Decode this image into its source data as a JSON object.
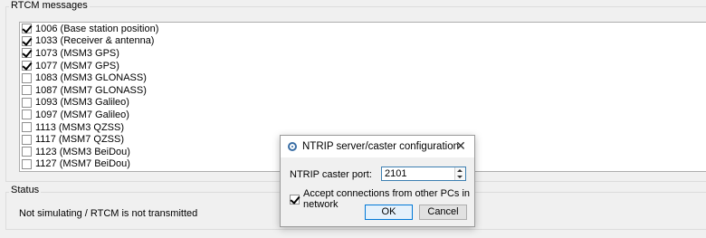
{
  "rtcm": {
    "title": "RTCM messages",
    "items": [
      {
        "label": "1006 (Base station position)",
        "checked": true
      },
      {
        "label": "1033 (Receiver & antenna)",
        "checked": true
      },
      {
        "label": "1073 (MSM3 GPS)",
        "checked": true
      },
      {
        "label": "1077 (MSM7 GPS)",
        "checked": true
      },
      {
        "label": "1083 (MSM3 GLONASS)",
        "checked": false
      },
      {
        "label": "1087 (MSM7 GLONASS)",
        "checked": false
      },
      {
        "label": "1093 (MSM3 Galileo)",
        "checked": false
      },
      {
        "label": "1097 (MSM7 Galileo)",
        "checked": false
      },
      {
        "label": "1113 (MSM3 QZSS)",
        "checked": false
      },
      {
        "label": "1117 (MSM7 QZSS)",
        "checked": false
      },
      {
        "label": "1123 (MSM3 BeiDou)",
        "checked": false
      },
      {
        "label": "1127 (MSM7 BeiDou)",
        "checked": false
      }
    ]
  },
  "status": {
    "title": "Status",
    "text": "Not simulating / RTCM is not transmitted"
  },
  "dialog": {
    "title": "NTRIP server/caster configuration",
    "port_label": "NTRIP caster port:",
    "port_value": "2101",
    "accept_label": "Accept connections from other PCs in network",
    "accept_checked": true,
    "ok_label": "OK",
    "cancel_label": "Cancel",
    "icons": {
      "title": "ntrip-icon",
      "close": "close-icon"
    }
  }
}
